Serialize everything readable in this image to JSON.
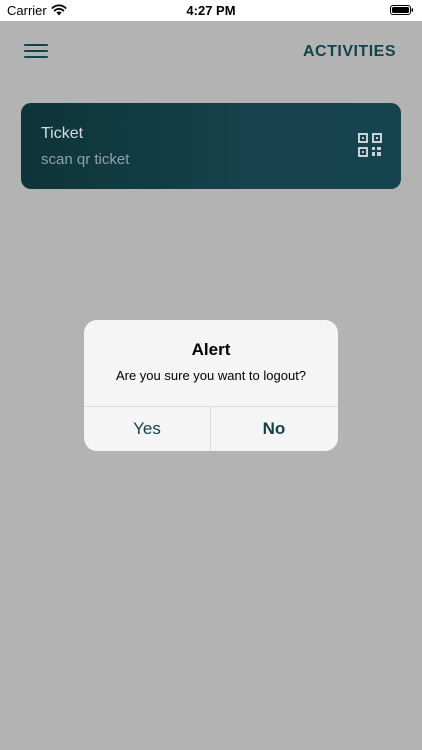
{
  "status_bar": {
    "carrier": "Carrier",
    "time": "4:27 PM"
  },
  "header": {
    "title": "ACTIVITIES",
    "menu_icon": "hamburger-menu-icon"
  },
  "ticket_card": {
    "title": "Ticket",
    "subtitle": "scan qr ticket",
    "icon": "qr-code-icon"
  },
  "alert": {
    "title": "Alert",
    "message": "Are you sure you want to logout?",
    "yes_label": "Yes",
    "no_label": "No"
  },
  "colors": {
    "accent": "#15434b",
    "overlay_background": "#b3b3b3",
    "card_gradient_start": "#0d3439",
    "card_gradient_end": "#15434e"
  }
}
